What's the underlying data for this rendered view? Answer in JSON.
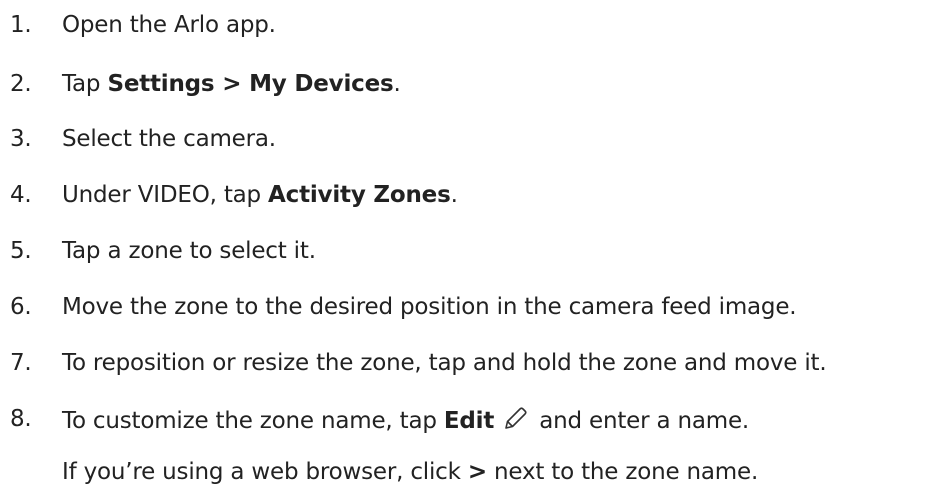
{
  "steps": [
    {
      "num": "1.",
      "text": "Open the Arlo app."
    },
    {
      "num": "2.",
      "pre": "Tap ",
      "bold": "Settings > My Devices",
      "post": "."
    },
    {
      "num": "3.",
      "text": "Select the camera."
    },
    {
      "num": "4.",
      "pre": "Under VIDEO, tap ",
      "bold": "Activity Zones",
      "post": "."
    },
    {
      "num": "5.",
      "text": "Tap a zone to select it."
    },
    {
      "num": "6.",
      "text": "Move the zone to the desired position in the camera feed image."
    },
    {
      "num": "7.",
      "text": "To reposition or resize the zone, tap and hold the zone and move it."
    },
    {
      "num": "8.",
      "pre": "To customize the zone name, tap ",
      "bold": "Edit",
      "post": " and enter a name.",
      "icon": "pencil-edit-icon"
    }
  ],
  "note": {
    "pre": "If you’re using a web browser, click ",
    "bold": ">",
    "post": " next to the zone name."
  },
  "colors": {
    "text": "#222222",
    "icon_stroke": "#333333"
  }
}
